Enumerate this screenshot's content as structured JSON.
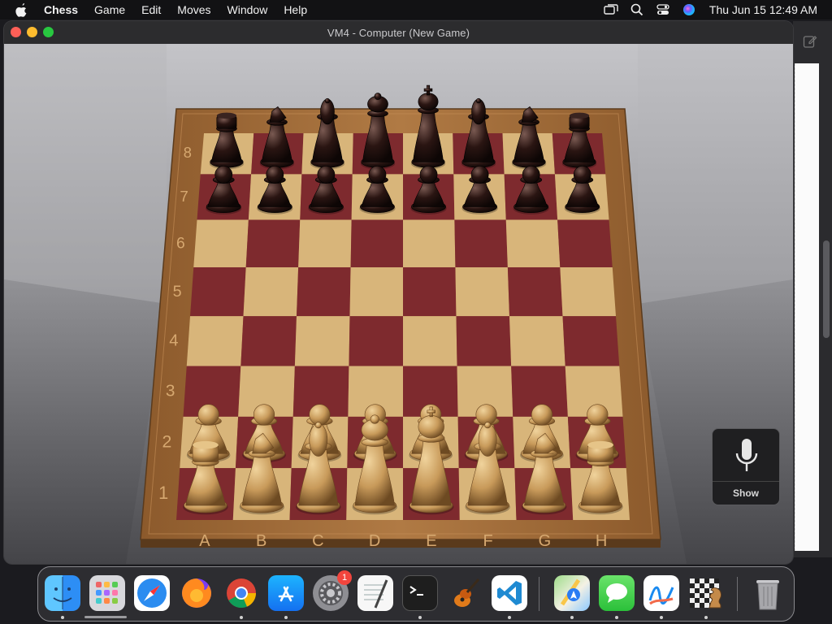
{
  "menubar": {
    "app_name": "Chess",
    "items": [
      "Game",
      "Edit",
      "Moves",
      "Window",
      "Help"
    ],
    "clock": "Thu Jun 15  12:49 AM",
    "icons": [
      "apple-icon",
      "screen-mirror-icon",
      "spotlight-icon",
      "control-center-icon",
      "siri-icon"
    ]
  },
  "window": {
    "title": "VM4 - Computer   (New Game)"
  },
  "board": {
    "files": [
      "A",
      "B",
      "C",
      "D",
      "E",
      "F",
      "G",
      "H"
    ],
    "ranks": [
      "1",
      "2",
      "3",
      "4",
      "5",
      "6",
      "7",
      "8"
    ],
    "back_rank": [
      "rook",
      "knight",
      "bishop",
      "queen",
      "king",
      "bishop",
      "knight",
      "rook"
    ],
    "colors": {
      "light_square": "#d8b57a",
      "dark_square": "#7e2a2e",
      "frame": "#a4703e",
      "white_piece": "#c89a5a",
      "black_piece": "#2a1512"
    }
  },
  "voice_control": {
    "label": "Show"
  },
  "dock": {
    "apps": [
      {
        "name": "Finder",
        "icon": "finder-icon",
        "running": true
      },
      {
        "name": "Launchpad",
        "icon": "launchpad-icon",
        "running": false
      },
      {
        "name": "Safari",
        "icon": "safari-icon",
        "running": false
      },
      {
        "name": "Firefox",
        "icon": "firefox-icon",
        "running": false
      },
      {
        "name": "Chrome",
        "icon": "chrome-icon",
        "running": true
      },
      {
        "name": "App Store",
        "icon": "app-store-icon",
        "running": true
      },
      {
        "name": "System Settings",
        "icon": "system-settings-icon",
        "running": false,
        "badge": "1"
      },
      {
        "name": "TextEdit",
        "icon": "textedit-icon",
        "running": false
      },
      {
        "name": "Terminal",
        "icon": "terminal-icon",
        "running": true
      },
      {
        "name": "GarageBand",
        "icon": "garageband-icon",
        "running": false
      },
      {
        "name": "VS Code",
        "icon": "vscode-icon",
        "running": true
      },
      {
        "name": "Maps",
        "icon": "maps-icon",
        "running": true
      },
      {
        "name": "Messages",
        "icon": "messages-icon",
        "running": true
      },
      {
        "name": "Freeform",
        "icon": "freeform-icon",
        "running": true
      },
      {
        "name": "Chess",
        "icon": "chess-icon",
        "running": true
      },
      {
        "name": "Trash",
        "icon": "trash-icon",
        "running": false
      }
    ]
  }
}
